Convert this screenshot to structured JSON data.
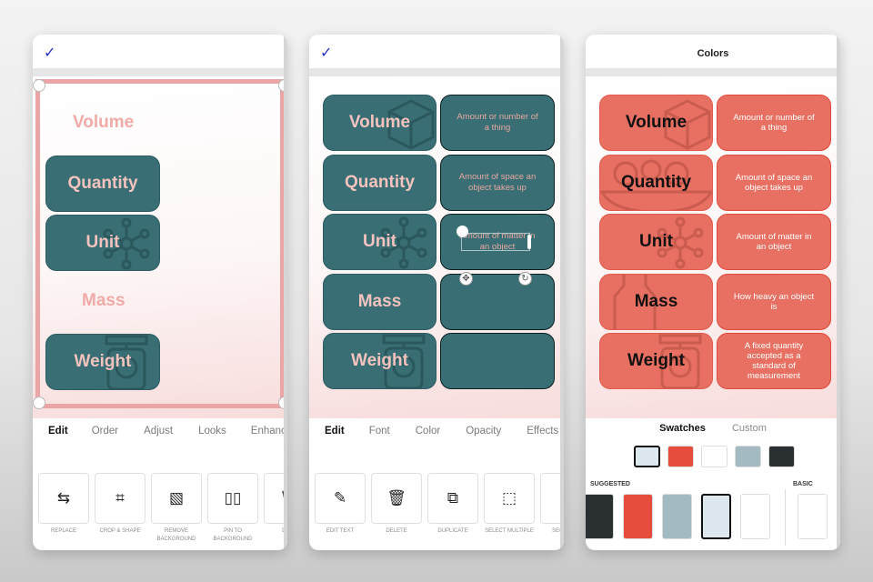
{
  "panels": [
    {
      "id": "edit-image",
      "confirm_icon": "✓",
      "canvas": {
        "floating_words": [
          "Volume",
          "Mass"
        ],
        "cards": [
          "Quantity",
          "Unit",
          "Weight"
        ]
      },
      "tabs": [
        {
          "label": "Edit",
          "active": true
        },
        {
          "label": "Order"
        },
        {
          "label": "Adjust"
        },
        {
          "label": "Looks"
        },
        {
          "label": "Enhance"
        }
      ],
      "tools": [
        {
          "icon": "replace-icon",
          "glyph": "⇆",
          "label": "Replace"
        },
        {
          "icon": "crop-icon",
          "glyph": "⌗",
          "label": "Crop & Shape"
        },
        {
          "icon": "remove-background-icon",
          "glyph": "▧",
          "label": "Remove Background"
        },
        {
          "icon": "pin-icon",
          "glyph": "▯▯",
          "label": "Pin To Background"
        },
        {
          "icon": "delete-icon",
          "glyph": "🗑",
          "label": "Dele"
        }
      ]
    },
    {
      "id": "edit-text",
      "confirm_icon": "✓",
      "rows": [
        {
          "term": "Volume",
          "definition": "Amount or number of a thing"
        },
        {
          "term": "Quantity",
          "definition": "Amount of space an object takes up"
        },
        {
          "term": "Unit",
          "definition": "Amount of matter in an object"
        },
        {
          "term": "Mass",
          "definition": ""
        },
        {
          "term": "Weight",
          "definition": ""
        }
      ],
      "tabs": [
        {
          "label": "Edit",
          "active": true
        },
        {
          "label": "Font"
        },
        {
          "label": "Color"
        },
        {
          "label": "Opacity"
        },
        {
          "label": "Effects"
        }
      ],
      "tools": [
        {
          "icon": "pencil-icon",
          "glyph": "✎",
          "label": "Edit Text"
        },
        {
          "icon": "delete-icon",
          "glyph": "🗑",
          "label": "Delete"
        },
        {
          "icon": "duplicate-icon",
          "glyph": "⧉",
          "label": "Duplicate"
        },
        {
          "icon": "select-multiple-icon",
          "glyph": "⬚",
          "label": "Select Multiple"
        },
        {
          "icon": "secondary-font-icon",
          "glyph": "A",
          "label": "Seconda"
        }
      ]
    },
    {
      "id": "colors",
      "title": "Colors",
      "rows": [
        {
          "term": "Volume",
          "definition": "Amount or number of a thing"
        },
        {
          "term": "Quantity",
          "definition": "Amount of space an object takes up"
        },
        {
          "term": "Unit",
          "definition": "Amount of matter in an object"
        },
        {
          "term": "Mass",
          "definition": "How heavy an object is"
        },
        {
          "term": "Weight",
          "definition": "A fixed quantity accepted as a standard of measurement"
        }
      ],
      "swatch_tabs": [
        {
          "label": "Swatches",
          "active": true
        },
        {
          "label": "Custom"
        }
      ],
      "swatches": [
        "#dde7ee",
        "#e84c3d",
        "#ffffff",
        "#a3bac3",
        "#2a2f32"
      ],
      "selected_swatch": 0,
      "sections": {
        "suggested": "SUGGESTED",
        "basic": "BASIC"
      },
      "suggested": [
        "#2a2f32",
        "#e84c3d",
        "#a3bac3",
        "#dde7ee",
        "#ffffff"
      ],
      "selected_suggested": 3,
      "basic": [
        "#ffffff",
        "#ffffff"
      ]
    }
  ],
  "colors": {
    "teal": "#386e74",
    "coral": "#e87062",
    "pink_text": "#f4c3be",
    "selection": "#eaa5a4",
    "check": "#2b2bd4"
  }
}
